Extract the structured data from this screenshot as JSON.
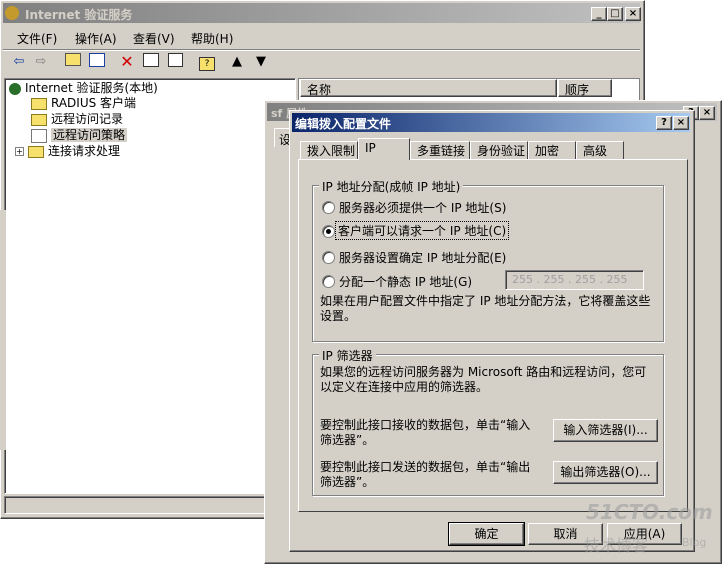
{
  "mmc": {
    "title": "Internet 验证服务",
    "menu": [
      "文件(F)",
      "操作(A)",
      "查看(V)",
      "帮助(H)"
    ],
    "tree_root": "Internet 验证服务(本地)",
    "tree_items": [
      "RADIUS 客户端",
      "远程访问记录",
      "远程访问策略",
      "连接请求处理"
    ],
    "columns": [
      "名称",
      "顺序"
    ]
  },
  "back_window": {
    "title_fragment": "sf 屋性",
    "tab_fragment": "设"
  },
  "dialog": {
    "title": "编辑拨入配置文件",
    "tabs": [
      "拨入限制",
      "IP",
      "多重链接",
      "身份验证",
      "加密",
      "高级"
    ],
    "active_tab": "IP",
    "ip_group": {
      "title": "IP 地址分配(成帧 IP 地址)",
      "options": [
        "服务器必须提供一个 IP 地址(S)",
        "客户端可以请求一个 IP 地址(C)",
        "服务器设置确定 IP 地址分配(E)",
        "分配一个静态 IP 地址(G)"
      ],
      "selected_index": 1,
      "static_ip": "255 . 255 . 255 . 255",
      "note": "如果在用户配置文件中指定了 IP 地址分配方法，它将覆盖这些设置。"
    },
    "filter_group": {
      "title": "IP 筛选器",
      "desc": "如果您的远程访问服务器为 Microsoft 路由和远程访问，您可以定义在连接中应用的筛选器。",
      "input_text": "要控制此接口接收的数据包，单击“输入筛选器”。",
      "input_btn": "输入筛选器(I)...",
      "output_text": "要控制此接口发送的数据包，单击“输出筛选器”。",
      "output_btn": "输出筛选器(O)..."
    },
    "buttons": {
      "ok": "确定",
      "cancel": "取消",
      "apply": "应用(A)"
    }
  },
  "watermark": {
    "line1": "51CTO.com",
    "line2": "技术博客",
    "line3": "Blog"
  }
}
